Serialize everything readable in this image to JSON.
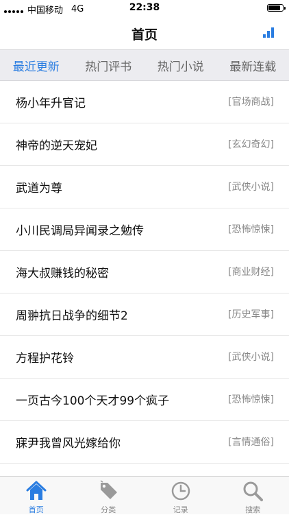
{
  "status_bar": {
    "carrier": "中国移动",
    "network": "4G",
    "time": "22:38",
    "battery_level": 0.85
  },
  "nav": {
    "title": "首页"
  },
  "tabs": [
    {
      "label": "最近更新",
      "active": true
    },
    {
      "label": "热门评书",
      "active": false
    },
    {
      "label": "热门小说",
      "active": false
    },
    {
      "label": "最新连载",
      "active": false
    }
  ],
  "books": [
    {
      "title": "杨小年升官记",
      "category": "[官场商战]"
    },
    {
      "title": "神帝的逆天宠妃",
      "category": "[玄幻奇幻]"
    },
    {
      "title": "武道为尊",
      "category": "[武侠小说]"
    },
    {
      "title": "小川民调局异闻录之勉传",
      "category": "[恐怖惊悚]"
    },
    {
      "title": "海大叔赚钱的秘密",
      "category": "[商业财经]"
    },
    {
      "title": "周翀抗日战争的细节2",
      "category": "[历史军事]"
    },
    {
      "title": "方程护花铃",
      "category": "[武侠小说]"
    },
    {
      "title": "一页古今100个天才99个疯子",
      "category": "[恐怖惊悚]"
    },
    {
      "title": "寐尹我曾风光嫁给你",
      "category": "[言情通俗]"
    }
  ],
  "bottom_tabs": [
    {
      "label": "首页",
      "icon": "home-icon",
      "active": true
    },
    {
      "label": "分类",
      "icon": "tag-icon",
      "active": false
    },
    {
      "label": "记录",
      "icon": "clock-icon",
      "active": false
    },
    {
      "label": "搜索",
      "icon": "search-icon",
      "active": false
    }
  ],
  "colors": {
    "accent": "#2a7de1",
    "tab_bar_bg": "#ececf0",
    "inactive_icon": "#9a9a9a"
  }
}
